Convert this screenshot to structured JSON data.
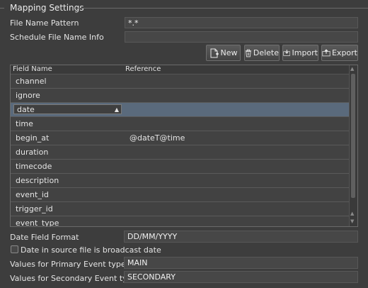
{
  "group": {
    "title": "Mapping Settings"
  },
  "file_name_pattern": {
    "label": "File Name Pattern",
    "value": "*.*"
  },
  "schedule_file_name_info": {
    "label": "Schedule File Name Info",
    "value": ""
  },
  "toolbar": {
    "new_label": "New",
    "delete_label": "Delete",
    "import_label": "Import",
    "export_label": "Export"
  },
  "table": {
    "columns": [
      "Field Name",
      "Reference"
    ],
    "rows": [
      {
        "field": "channel",
        "reference": ""
      },
      {
        "field": "ignore",
        "reference": ""
      },
      {
        "field": "date",
        "reference": ""
      },
      {
        "field": "time",
        "reference": ""
      },
      {
        "field": "begin_at",
        "reference": "@dateT@time"
      },
      {
        "field": "duration",
        "reference": ""
      },
      {
        "field": "timecode",
        "reference": ""
      },
      {
        "field": "description",
        "reference": ""
      },
      {
        "field": "event_id",
        "reference": ""
      },
      {
        "field": "trigger_id",
        "reference": ""
      },
      {
        "field": "event_type",
        "reference": ""
      }
    ],
    "selected_row": 2
  },
  "date_field_format": {
    "label": "Date Field Format",
    "value": "DD/MM/YYYY"
  },
  "broadcast_date_checkbox": {
    "label": "Date in source file is broadcast date",
    "checked": false
  },
  "primary_event_types": {
    "label": "Values for Primary Event types",
    "value": "MAIN"
  },
  "secondary_event_types": {
    "label": "Values for Secondary Event types",
    "value": "SECONDARY"
  }
}
